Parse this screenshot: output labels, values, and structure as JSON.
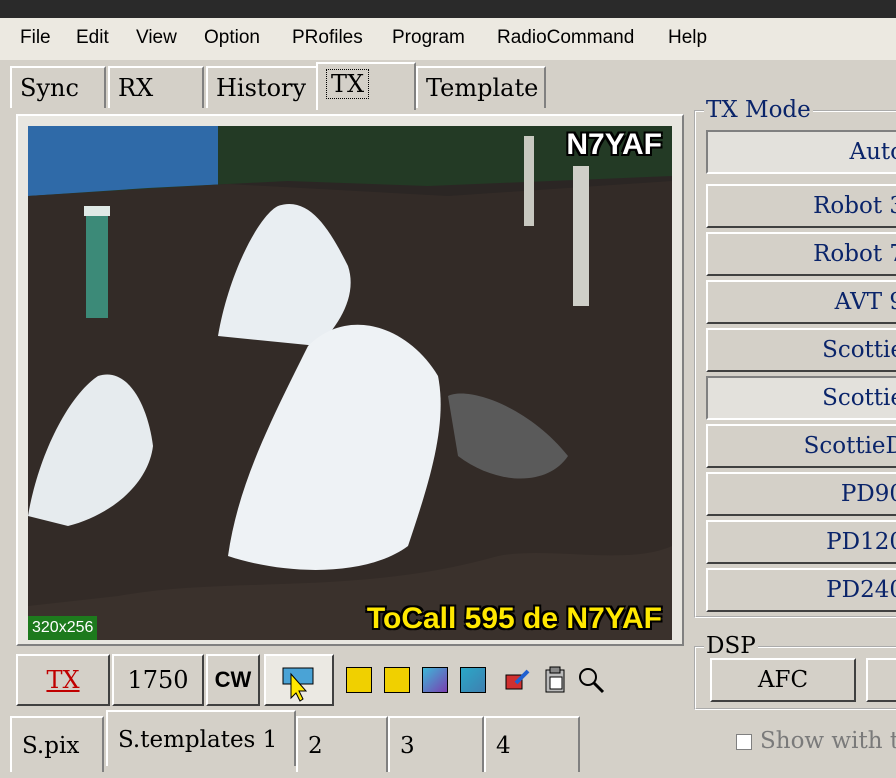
{
  "menu": [
    "File",
    "Edit",
    "View",
    "Option",
    "PRofiles",
    "Program",
    "RadioCommand",
    "Help"
  ],
  "tabs": [
    "Sync",
    "RX",
    "History",
    "TX",
    "Template"
  ],
  "image": {
    "callsign": "N7YAF",
    "tocall": "ToCall 595 de N7YAF",
    "size": "320x256"
  },
  "toolbar": {
    "tx": "TX",
    "tone": "1750",
    "cw": "CW"
  },
  "bottom_tabs": [
    "S.pix",
    "S.templates 1",
    "2",
    "3",
    "4"
  ],
  "tx_mode": {
    "title": "TX Mode",
    "modes": [
      "Auto",
      "Robot 3",
      "Robot 7",
      "AVT 9",
      "Scottie",
      "Scottie",
      "ScottieD",
      "PD90",
      "PD120",
      "PD240"
    ]
  },
  "dsp": {
    "title": "DSP",
    "afc": "AFC"
  },
  "show_with": "Show with t"
}
